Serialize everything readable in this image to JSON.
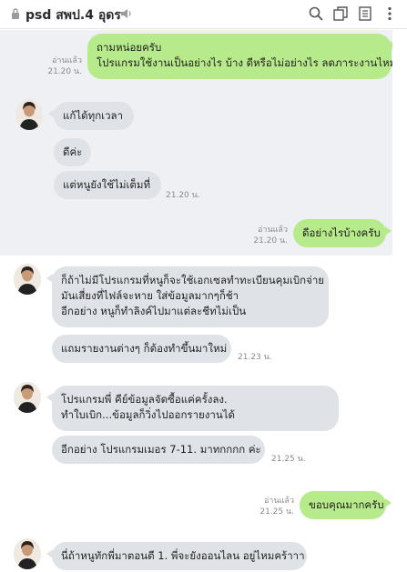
{
  "header": {
    "title": "psd สพป.4 อุดร",
    "icons": [
      "lock-icon",
      "speaker-icon",
      "search-icon",
      "copy-icon",
      "notes-icon",
      "more-icon"
    ]
  },
  "messages": {
    "m1_text": "ถามหน่อยครับ\nโปรแกรมใช้งานเป็นอย่างไร บ้าง ดีหรือไม่อย่างไร ลดภาระงานไหม",
    "m1_read": "อ่านแล้ว",
    "m1_time": "21.20 น.",
    "m2_text": "แก้ได้ทุกเวลา",
    "m3_text": "ดีค่ะ",
    "m4_text": "แต่หนูยังใช้ไม่เต็มที่",
    "m4_time": "21.20 น.",
    "m5_text": "ดีอย่างไรบ้างครับ",
    "m5_read": "อ่านแล้ว",
    "m5_time": "21.20 น.",
    "m6_text": "ก็ถ้าไม่มีโปรแกรมที่หนูก็จะใช้เอกเซลทำทะเบียนคุมเบิกจ่าย\nมันเสี่ยงที่ไฟล์จะหาย ใส่ข้อมูลมากๆก็ช้า\nอีกอย่าง หนูก็ทำลิงค์ไปมาแต่ละชีทไม่เป็น",
    "m7_text": "แถมรายงานต่างๆ ก็ต้องทำขึ้นมาใหม่",
    "m7_time": "21.23 น.",
    "m8_text": "โปรแกรมพี่ คีย์ข้อมูลจัดซื้อแค่ครั้งลง.\nทำใบเบิก...ข้อมูลก็วิ่งไปออกรายงานได้",
    "m9_text": "อีกอย่าง โปรแกรมเมอร 7-11. มาทกกกก ค่ะ",
    "m9_time": "21.25 น.",
    "m10_text": "ขอบคุณมากครับ",
    "m10_read": "อ่านแล้ว",
    "m10_time": "21.25 น.",
    "m11_text": "นี่ถ้าหนูทักพี่มาตอนตี 1. พี่จะยังออนไลน อยู่ไหมคร้าาา"
  },
  "colors": {
    "outgoing_bubble": "#b7ea8b",
    "incoming_bubble": "#dfe3e8",
    "chat_background": "#eef0f3"
  }
}
